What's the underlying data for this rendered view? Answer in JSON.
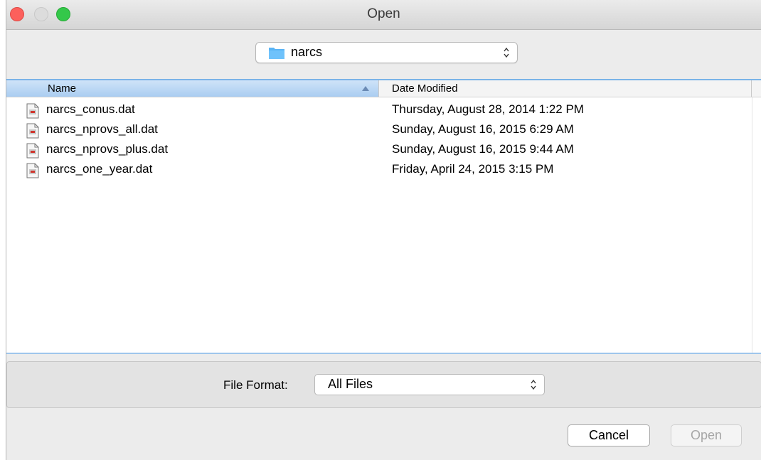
{
  "window": {
    "title": "Open"
  },
  "folder": {
    "current": "narcs"
  },
  "columns": {
    "name": "Name",
    "date": "Date Modified"
  },
  "files": [
    {
      "name": "narcs_conus.dat",
      "modified": "Thursday, August 28, 2014 1:22 PM"
    },
    {
      "name": "narcs_nprovs_all.dat",
      "modified": "Sunday, August 16, 2015 6:29 AM"
    },
    {
      "name": "narcs_nprovs_plus.dat",
      "modified": "Sunday, August 16, 2015 9:44 AM"
    },
    {
      "name": "narcs_one_year.dat",
      "modified": "Friday, April 24, 2015 3:15 PM"
    }
  ],
  "format": {
    "label": "File Format:",
    "selected": "All Files"
  },
  "buttons": {
    "cancel": "Cancel",
    "open": "Open"
  },
  "icons": {
    "folder": "folder-icon",
    "file": "document-icon",
    "sort": "sort-ascending-icon",
    "stepper": "up-down-chevron-icon"
  },
  "colors": {
    "close": "#fc605c",
    "minimize": "#dcdcdc",
    "maximize": "#34c84a",
    "selection": "#aacdf1",
    "folder": "#5ab4f5"
  }
}
